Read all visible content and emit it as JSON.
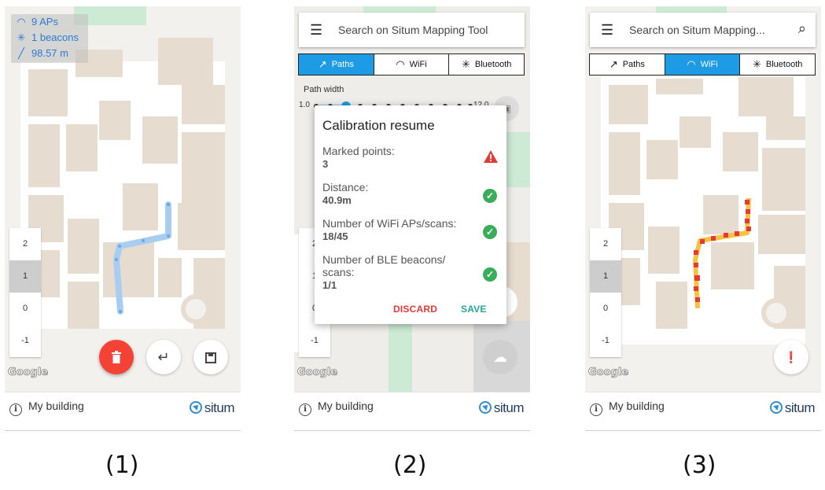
{
  "panel1": {
    "stats": {
      "aps": "9 APs",
      "beacons": "1 beacons",
      "distance": "98.57 m"
    },
    "floors": [
      "2",
      "1",
      "0",
      "-1"
    ],
    "selected_floor": "1",
    "google": "Google",
    "buttons": {
      "delete_icon": "trash-icon",
      "undo_icon": "undo-icon",
      "save_icon": "save-icon"
    },
    "building": "My building",
    "logo": "situm",
    "caption": "(1)"
  },
  "panel2": {
    "search_placeholder": "Search on Situm Mapping Tool",
    "tabs": [
      {
        "label": "Paths",
        "icon": "trend-icon",
        "active": true
      },
      {
        "label": "WiFi",
        "icon": "wifi-icon",
        "active": false
      },
      {
        "label": "Bluetooth",
        "icon": "bluetooth-icon",
        "active": false
      }
    ],
    "path_width_label": "Path width",
    "slider": {
      "min": "1.0",
      "max": "12.0",
      "value": 1.0
    },
    "dialog": {
      "title": "Calibration resume",
      "rows": [
        {
          "label": "Marked points:",
          "value": "3",
          "status": "warning"
        },
        {
          "label": "Distance:",
          "value": "40.9m",
          "status": "ok"
        },
        {
          "label": "Number of WiFi APs/scans:",
          "value": "18/45",
          "status": "ok"
        },
        {
          "label": "Number of BLE beacons/ scans:",
          "value": "1/1",
          "status": "ok"
        }
      ],
      "discard": "DISCARD",
      "save": "SAVE"
    },
    "floors": [
      "2",
      "1",
      "0",
      "-1"
    ],
    "google": "Google",
    "building": "My building",
    "logo": "situm",
    "caption": "(2)"
  },
  "panel3": {
    "search_placeholder": "Search on Situm Mapping...",
    "tabs": [
      {
        "label": "Paths",
        "icon": "trend-icon",
        "active": false
      },
      {
        "label": "WiFi",
        "icon": "wifi-icon",
        "active": true
      },
      {
        "label": "Bluetooth",
        "icon": "bluetooth-icon",
        "active": false
      }
    ],
    "floors": [
      "2",
      "1",
      "0",
      "-1"
    ],
    "selected_floor": "1",
    "google": "Google",
    "building": "My building",
    "logo": "situm",
    "caption": "(3)"
  },
  "colors": {
    "accent": "#1e9be5",
    "delete": "#f44336",
    "discard": "#e53935",
    "save": "#26a69a",
    "path": "#a9cdf0",
    "heat_red": "#e53935",
    "heat_yellow": "#f5c242",
    "map_room": "#e6dccf",
    "map_corridor": "#f2f1ee",
    "map_green": "#cdebd4"
  }
}
